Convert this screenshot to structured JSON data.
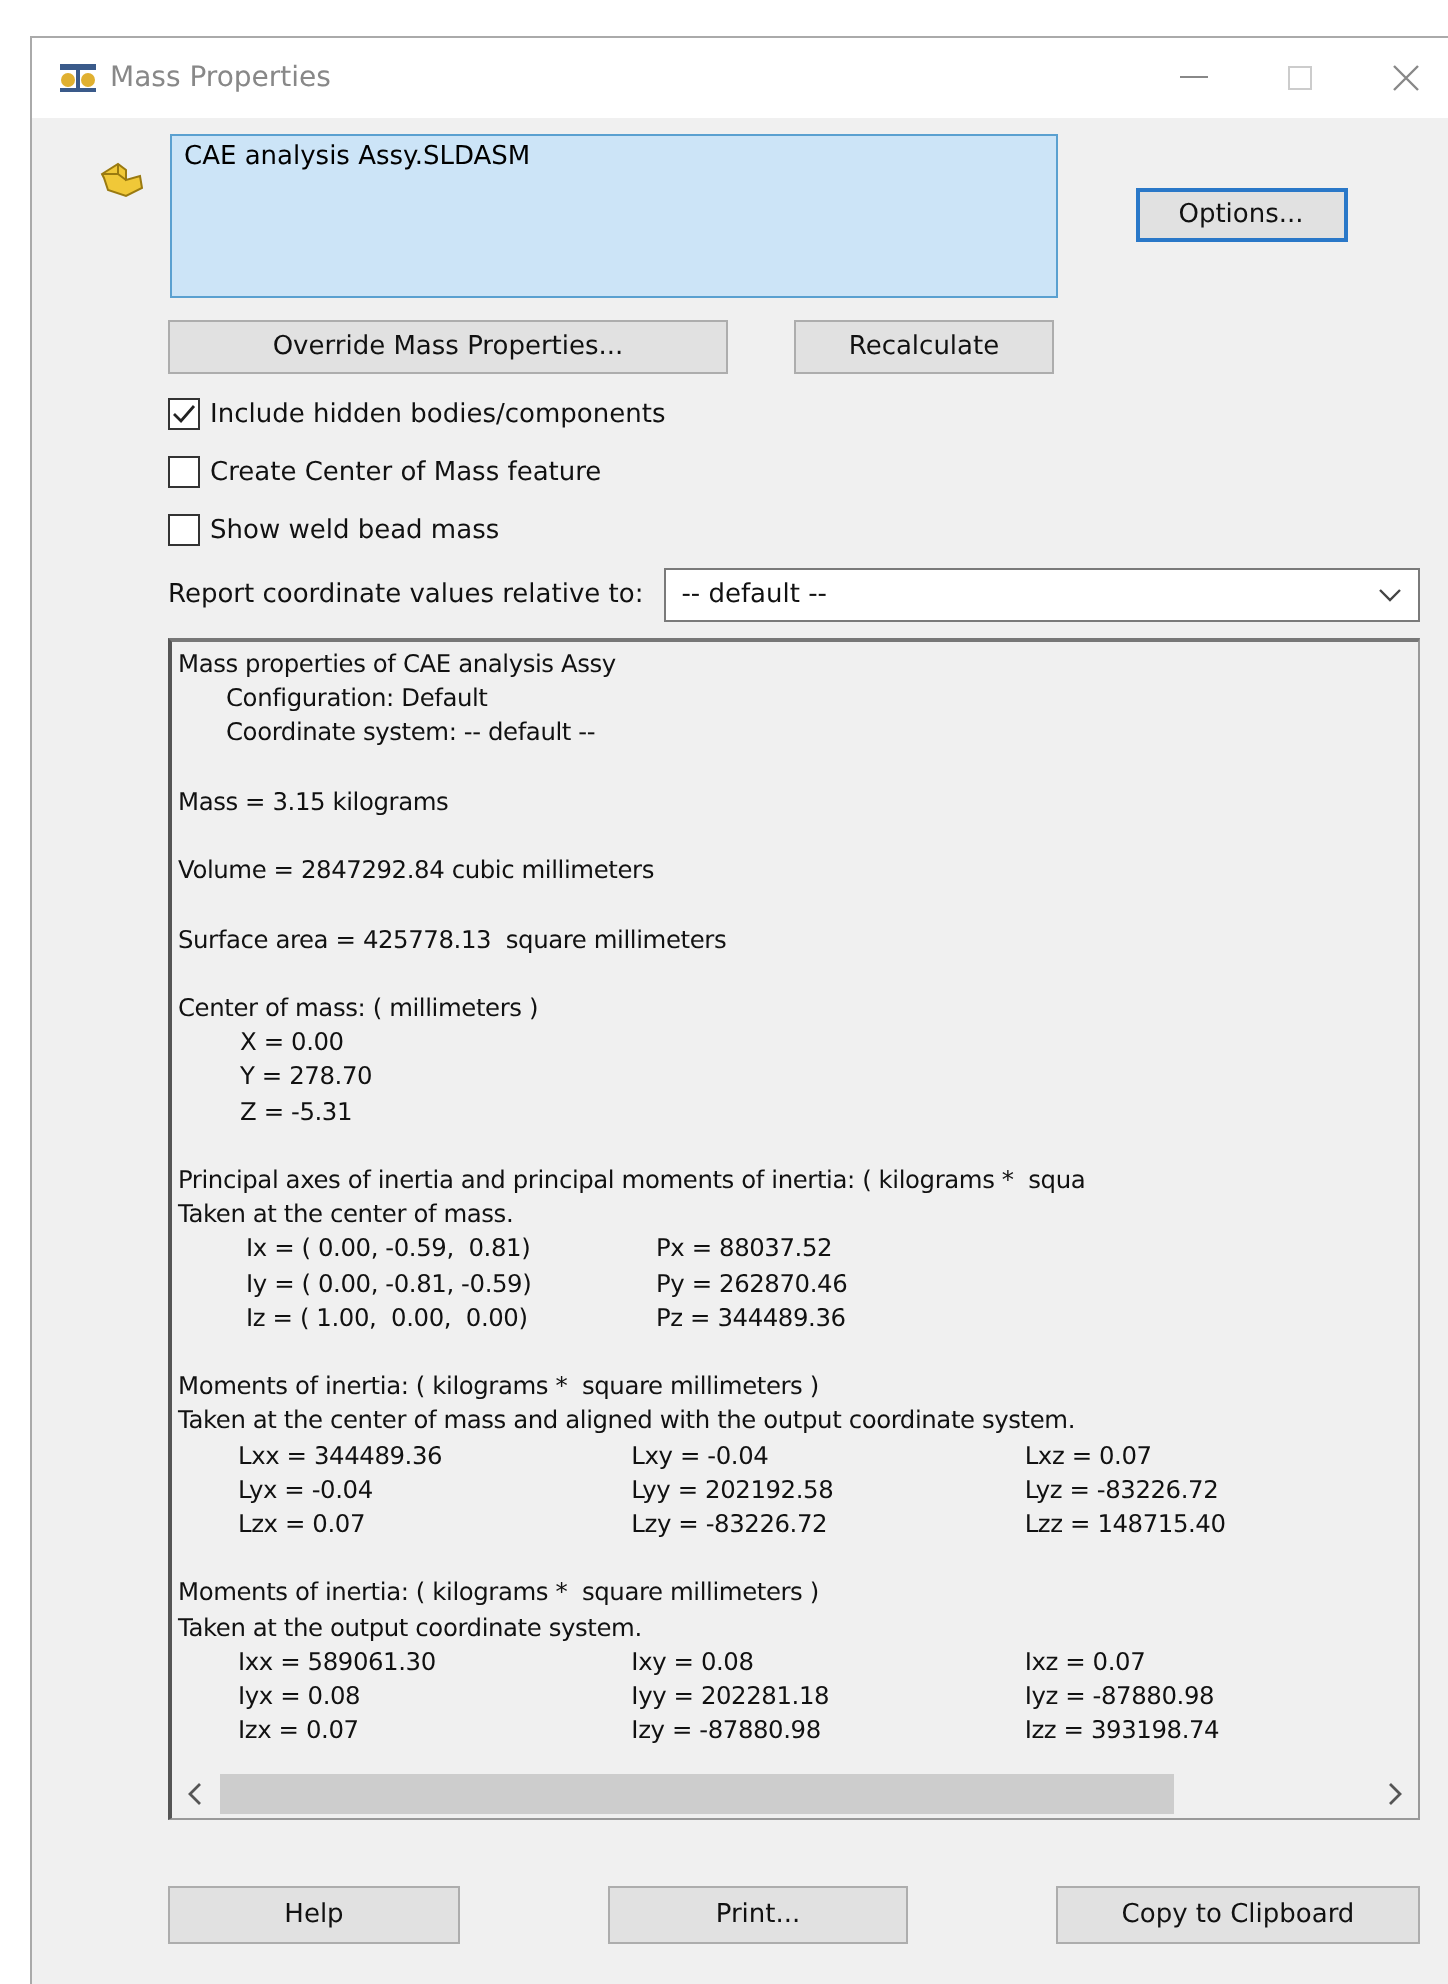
{
  "window": {
    "title": "Mass Properties"
  },
  "selection_list": {
    "items": [
      {
        "text": "CAE analysis Assy.SLDASM",
        "selected": true
      }
    ]
  },
  "buttons_top": {
    "options": "Options...",
    "override": "Override Mass Properties...",
    "recalculate": "Recalculate"
  },
  "checkboxes": [
    {
      "label": "Include hidden bodies/components",
      "checked": true
    },
    {
      "label": "Create Center of Mass feature",
      "checked": false
    },
    {
      "label": "Show weld bead mass",
      "checked": false
    }
  ],
  "coordinate": {
    "label": "Report coordinate values relative to:",
    "value": "-- default --"
  },
  "report": {
    "blocks": [
      {
        "lines": [
          {
            "kind": "plain",
            "text": "Mass properties of CAE analysis Assy"
          },
          {
            "kind": "indented",
            "text": "Configuration: Default"
          },
          {
            "kind": "indented",
            "text": "Coordinate system: -- default --"
          }
        ]
      },
      {
        "lines": [
          {
            "kind": "plain",
            "text": "Mass = 3.15 kilograms"
          }
        ]
      },
      {
        "lines": [
          {
            "kind": "plain",
            "text": "Volume = 2847292.84 cubic millimeters"
          }
        ]
      },
      {
        "lines": [
          {
            "kind": "plain",
            "text": "Surface area = 425778.13  square millimeters"
          }
        ]
      },
      {
        "lines": [
          {
            "kind": "plain",
            "text": "Center of mass: ( millimeters )"
          },
          {
            "kind": "value",
            "text": "X = 0.00"
          },
          {
            "kind": "value",
            "text": "Y = 278.70"
          },
          {
            "kind": "value",
            "text": "Z = -5.31"
          }
        ]
      },
      {
        "lines": [
          {
            "kind": "plain",
            "text": "Principal axes of inertia and principal moments of inertia: ( kilograms *  squa"
          },
          {
            "kind": "plain",
            "text": "Taken at the center of mass."
          },
          {
            "kind": "row",
            "cells": [
              "Ix = ( 0.00, -0.59,  0.81)",
              "Px = 88037.52"
            ]
          },
          {
            "kind": "row",
            "cells": [
              "Iy = ( 0.00, -0.81, -0.59)",
              "Py = 262870.46"
            ]
          },
          {
            "kind": "row",
            "cells": [
              "Iz = ( 1.00,  0.00,  0.00)",
              "Pz = 344489.36"
            ]
          }
        ]
      },
      {
        "lines": [
          {
            "kind": "plain",
            "text": "Moments of inertia: ( kilograms *  square millimeters )"
          },
          {
            "kind": "plain",
            "text": "Taken at the center of mass and aligned with the output coordinate system."
          },
          {
            "kind": "row",
            "cells": [
              "Lxx = 344489.36",
              "Lxy = -0.04",
              "Lxz = 0.07"
            ]
          },
          {
            "kind": "row",
            "cells": [
              "Lyx = -0.04",
              "Lyy = 202192.58",
              "Lyz = -83226.72"
            ]
          },
          {
            "kind": "row",
            "cells": [
              "Lzx = 0.07",
              "Lzy = -83226.72",
              "Lzz = 148715.40"
            ]
          }
        ]
      },
      {
        "lines": [
          {
            "kind": "plain",
            "text": "Moments of inertia: ( kilograms *  square millimeters )"
          },
          {
            "kind": "plain",
            "text": "Taken at the output coordinate system."
          },
          {
            "kind": "row",
            "cells": [
              "Ixx = 589061.30",
              "Ixy = 0.08",
              "Ixz = 0.07"
            ]
          },
          {
            "kind": "row",
            "cells": [
              "Iyx = 0.08",
              "Iyy = 202281.18",
              "Iyz = -87880.98"
            ]
          },
          {
            "kind": "row",
            "cells": [
              "Izx = 0.07",
              "Izy = -87880.98",
              "Izz = 393198.74"
            ]
          }
        ]
      }
    ]
  },
  "buttons_bottom": [
    "Help",
    "Print...",
    "Copy to Clipboard"
  ]
}
